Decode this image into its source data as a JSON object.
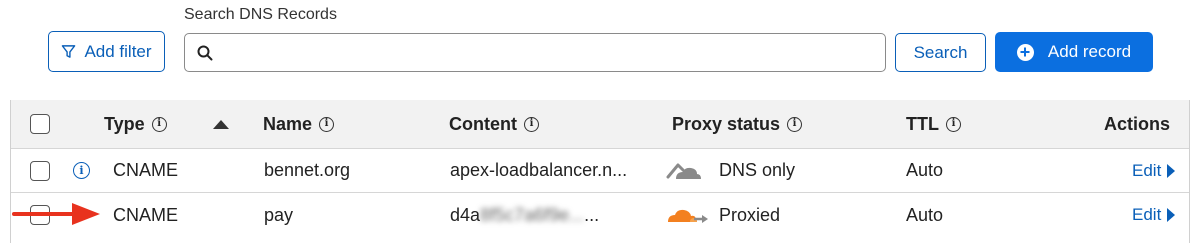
{
  "toolbar": {
    "filter_label": "Add filter",
    "search_label": "Search DNS Records",
    "search_value": "",
    "search_placeholder": "",
    "search_button": "Search",
    "add_button": "Add record"
  },
  "table": {
    "columns": [
      "Type",
      "Name",
      "Content",
      "Proxy status",
      "TTL",
      "Actions"
    ],
    "rows": [
      {
        "type": "CNAME",
        "name": "bennet.org",
        "content": "apex-loadbalancer.n...",
        "proxy_status": "DNS only",
        "ttl": "Auto",
        "action": "Edit"
      },
      {
        "type": "CNAME",
        "name": "pay",
        "content_visible": "d4a",
        "content_rest": "8f5c7a6f9e...",
        "content_suffix": "...",
        "proxy_status": "Proxied",
        "ttl": "Auto",
        "action": "Edit"
      }
    ]
  },
  "colors": {
    "accent": "#0b6fe0",
    "link": "#0a5fb8",
    "cloud_proxied": "#f38020",
    "cloud_dns_only": "#8a8a8a",
    "annotation_arrow": "#e8321e"
  }
}
